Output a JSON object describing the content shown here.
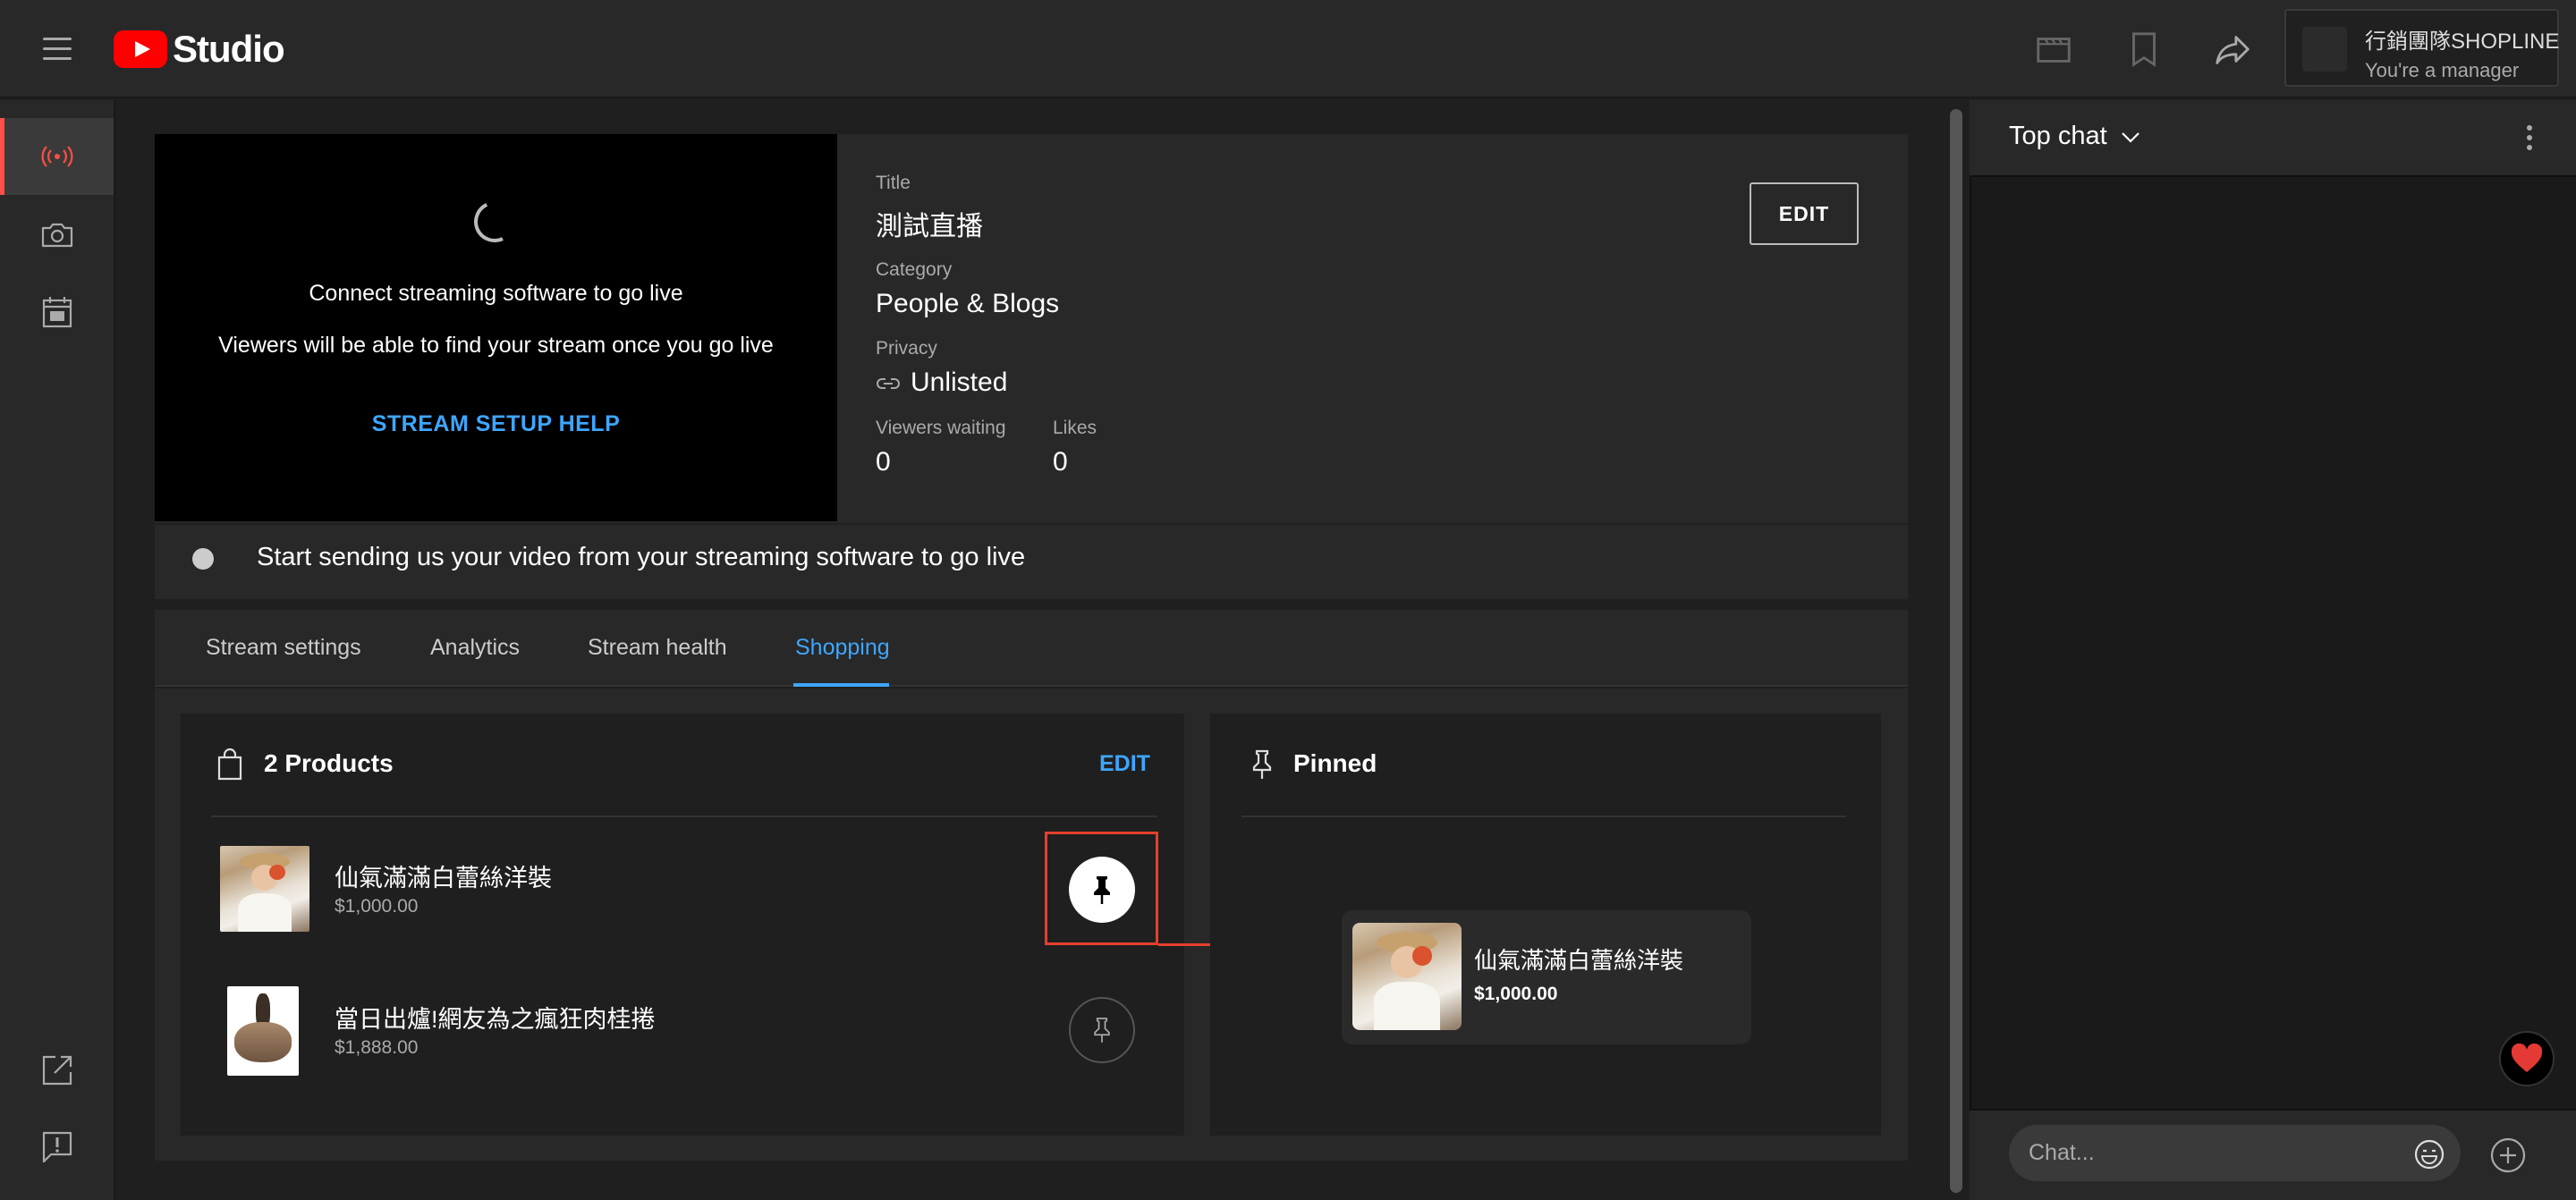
{
  "app": {
    "brand": "Studio"
  },
  "account": {
    "name": "行銷團隊SHOPLINE",
    "role": "You're a manager"
  },
  "preview": {
    "connect_text": "Connect streaming software to go live",
    "viewers_text": "Viewers will be able to find your stream once you go live",
    "help_link": "STREAM SETUP HELP"
  },
  "details": {
    "title_label": "Title",
    "title_value": "測試直播",
    "category_label": "Category",
    "category_value": "People & Blogs",
    "privacy_label": "Privacy",
    "privacy_value": "Unlisted",
    "viewers_label": "Viewers waiting",
    "viewers_value": "0",
    "likes_label": "Likes",
    "likes_value": "0",
    "edit_label": "EDIT"
  },
  "status": {
    "message": "Start sending us your video from your streaming software to go live"
  },
  "tabs": [
    {
      "label": "Stream settings",
      "active": false
    },
    {
      "label": "Analytics",
      "active": false
    },
    {
      "label": "Stream health",
      "active": false
    },
    {
      "label": "Shopping",
      "active": true
    }
  ],
  "products": {
    "title": "2 Products",
    "edit_label": "EDIT",
    "items": [
      {
        "name": "仙氣滿滿白蕾絲洋裝",
        "price": "$1,000.00",
        "pinned": true
      },
      {
        "name": "當日出爐!網友為之瘋狂肉桂捲",
        "price": "$1,888.00",
        "pinned": false
      }
    ]
  },
  "pinned": {
    "title": "Pinned",
    "item": {
      "name": "仙氣滿滿白蕾絲洋裝",
      "price": "$1,000.00"
    }
  },
  "chat": {
    "title": "Top chat",
    "placeholder": "Chat..."
  },
  "colors": {
    "accent": "#3ea6ff",
    "live": "#ff4e45",
    "annotation": "#e5402c",
    "brand_red": "#ff0000"
  }
}
